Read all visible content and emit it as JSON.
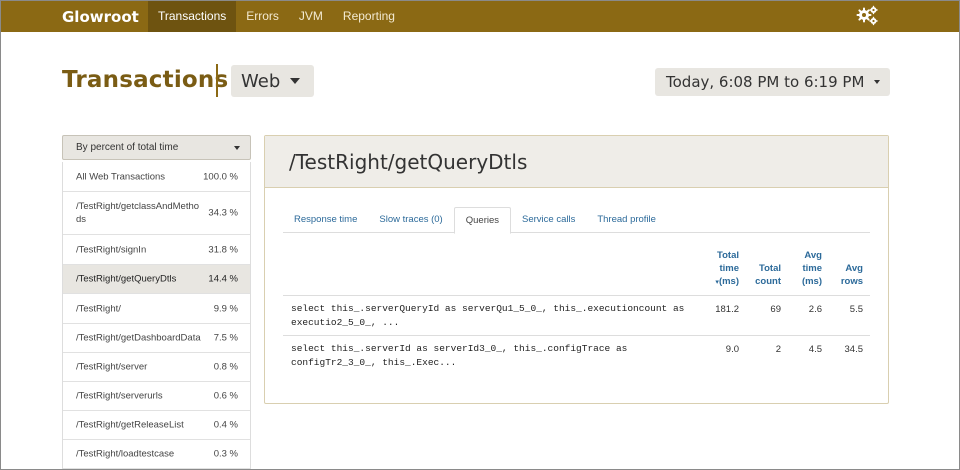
{
  "navbar": {
    "brand": "Glowroot",
    "items": [
      {
        "label": "Transactions",
        "active": true
      },
      {
        "label": "Errors",
        "active": false
      },
      {
        "label": "JVM",
        "active": false
      },
      {
        "label": "Reporting",
        "active": false
      }
    ],
    "settings_icon": "gears-icon"
  },
  "header": {
    "title": "Transactions",
    "type_selector": "Web",
    "time_range": "Today, 6:08 PM to 6:19 PM"
  },
  "sidebar": {
    "sort_label": "By percent of total time",
    "items": [
      {
        "name": "All Web Transactions",
        "pct": "100.0 %"
      },
      {
        "name": "/TestRight/getclassAndMethods",
        "pct": "34.3 %"
      },
      {
        "name": "/TestRight/signIn",
        "pct": "31.8 %"
      },
      {
        "name": "/TestRight/getQueryDtls",
        "pct": "14.4 %",
        "active": true
      },
      {
        "name": "/TestRight/",
        "pct": "9.9 %"
      },
      {
        "name": "/TestRight/getDashboardData",
        "pct": "7.5 %"
      },
      {
        "name": "/TestRight/server",
        "pct": "0.8 %"
      },
      {
        "name": "/TestRight/serverurls",
        "pct": "0.6 %"
      },
      {
        "name": "/TestRight/getReleaseList",
        "pct": "0.4 %"
      },
      {
        "name": "/TestRight/loadtestcase",
        "pct": "0.3 %"
      }
    ]
  },
  "main": {
    "title": "/TestRight/getQueryDtls",
    "tabs": [
      {
        "label": "Response time",
        "active": false
      },
      {
        "label": "Slow traces (0)",
        "active": false
      },
      {
        "label": "Queries",
        "active": true
      },
      {
        "label": "Service calls",
        "active": false
      },
      {
        "label": "Thread profile",
        "active": false
      }
    ],
    "table": {
      "headers": {
        "total_time_1": "Total",
        "total_time_2": "time",
        "total_time_sort": "▾",
        "total_time_3": "(ms)",
        "total_count_1": "Total",
        "total_count_2": "count",
        "avg_time_1": "Avg",
        "avg_time_2": "time",
        "avg_time_3": "(ms)",
        "avg_rows_1": "Avg",
        "avg_rows_2": "rows"
      },
      "rows": [
        {
          "query_line1": "select this_.serverQueryId as serverQu1_5_0_, this_.executioncount as",
          "query_line2": "executio2_5_0_, ...",
          "total_time": "181.2",
          "total_count": "69",
          "avg_time": "2.6",
          "avg_rows": "5.5"
        },
        {
          "query_line1": "select this_.serverId as serverId3_0_, this_.configTrace as",
          "query_line2": "configTr2_3_0_, this_.Exec...",
          "total_time": "9.0",
          "total_count": "2",
          "avg_time": "4.5",
          "avg_rows": "34.5"
        }
      ]
    }
  }
}
